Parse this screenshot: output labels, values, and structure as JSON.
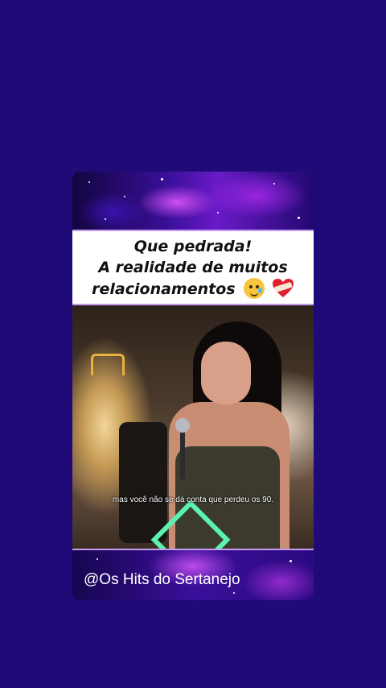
{
  "post": {
    "caption_lines": [
      "Que pedrada!",
      "A realidade de muitos",
      "relacionamentos"
    ],
    "subtitle": "mas você não se dá conta que perdeu os 90.",
    "handle": "@Os Hits do Sertanejo",
    "emojis": [
      "smiling-face-with-tear-icon",
      "heart-with-bandage-icon"
    ]
  },
  "colors": {
    "background": "#1f0a78",
    "caption_border": "#c79cf0",
    "accent_neon": "#5bf2b0"
  }
}
